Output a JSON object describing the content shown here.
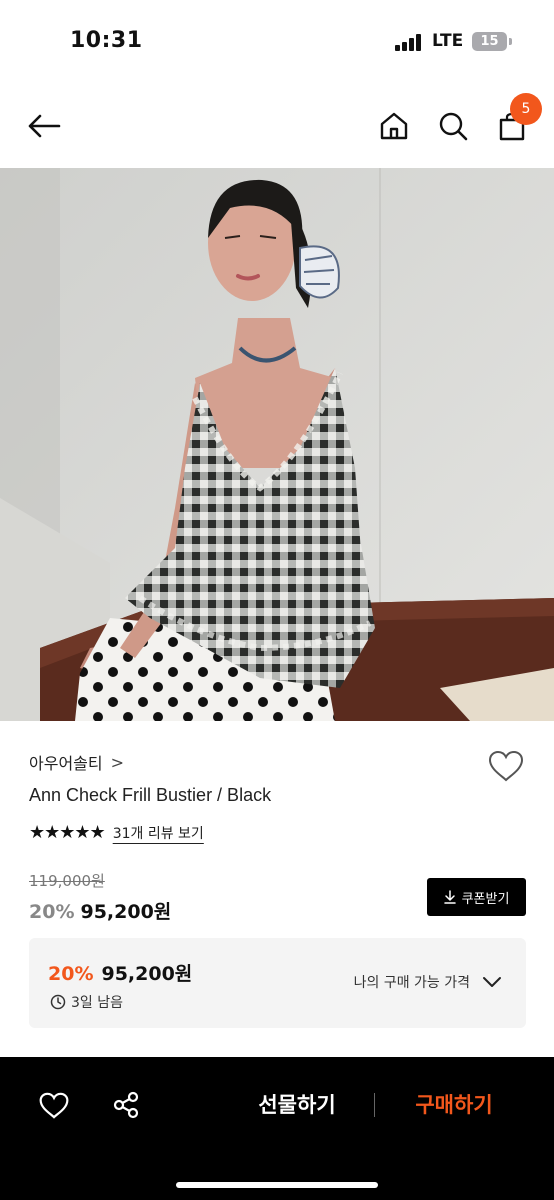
{
  "status_bar": {
    "time": "10:31",
    "network": "LTE",
    "battery": "15"
  },
  "nav": {
    "back_icon": "arrow-left-icon",
    "home_icon": "home-icon",
    "search_icon": "search-icon",
    "bag_icon": "shopping-bag-icon",
    "cart_count": "5"
  },
  "product": {
    "brand": "아우어솔티",
    "brand_chevron": ">",
    "name": "Ann Check Frill Bustier / Black",
    "stars": "★★★★★",
    "rating": 5,
    "review_link": "31개 리뷰 보기",
    "original_price": "119,000원",
    "discount": "20%",
    "sale_price": "95,200원",
    "coupon_button": "쿠폰받기"
  },
  "my_price": {
    "discount": "20%",
    "price": "95,200원",
    "timer": "3일 남음",
    "label": "나의 구매 가능 가격"
  },
  "bottom_bar": {
    "gift_label": "선물하기",
    "buy_label": "구매하기"
  },
  "colors": {
    "accent": "#f2571c",
    "bottom_bar_bg": "#000000",
    "price_box_bg": "#f4f4f4"
  }
}
